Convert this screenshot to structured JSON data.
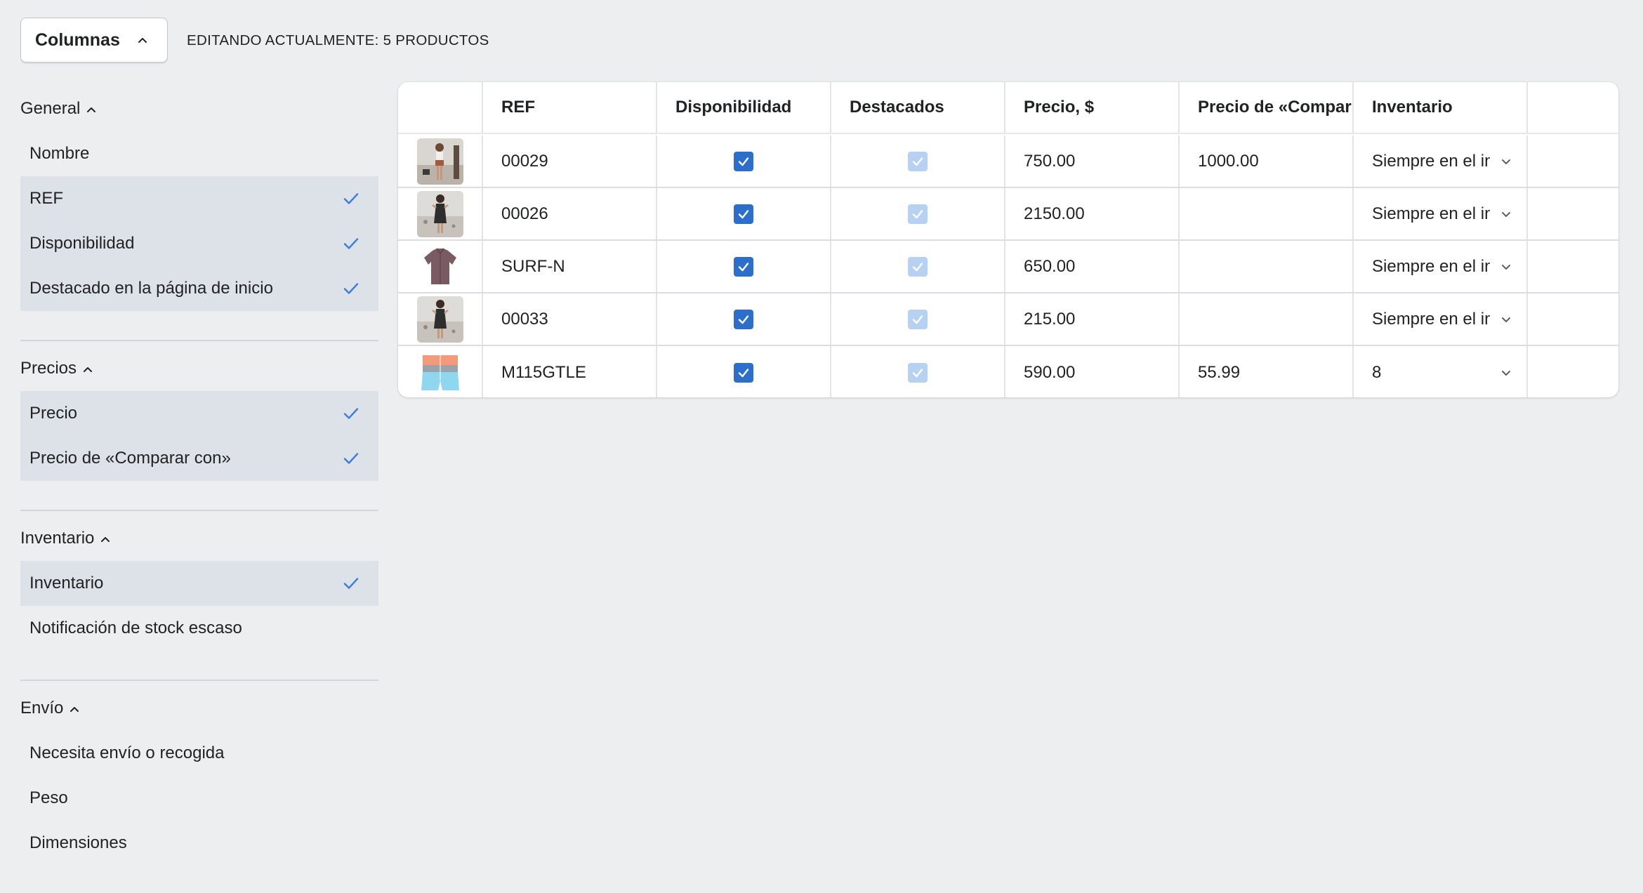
{
  "toolbar": {
    "columns_label": "Columnas",
    "editing_label": "EDITANDO ACTUALMENTE: 5 PRODUCTOS"
  },
  "sidebar": {
    "groups": [
      {
        "title": "General",
        "items": [
          {
            "label": "Nombre",
            "selected": false
          },
          {
            "label": "REF",
            "selected": true
          },
          {
            "label": "Disponibilidad",
            "selected": true
          },
          {
            "label": "Destacado en la página de inicio",
            "selected": true
          }
        ]
      },
      {
        "title": "Precios",
        "items": [
          {
            "label": "Precio",
            "selected": true
          },
          {
            "label": "Precio de «Comparar con»",
            "selected": true
          }
        ]
      },
      {
        "title": "Inventario",
        "items": [
          {
            "label": "Inventario",
            "selected": true
          },
          {
            "label": "Notificación de stock escaso",
            "selected": false
          }
        ]
      },
      {
        "title": "Envío",
        "items": [
          {
            "label": "Necesita envío o recogida",
            "selected": false
          },
          {
            "label": "Peso",
            "selected": false
          },
          {
            "label": "Dimensiones",
            "selected": false
          }
        ]
      }
    ]
  },
  "table": {
    "headers": {
      "ref": "REF",
      "availability": "Disponibilidad",
      "featured": "Destacados",
      "price": "Precio, $",
      "compare": "Precio de «Compar",
      "inventory": "Inventario"
    },
    "rows": [
      {
        "thumb": "woman-beach",
        "ref": "00029",
        "available": true,
        "featured": true,
        "price": "750.00",
        "compare": "1000.00",
        "inventory": "Siempre en el inventario"
      },
      {
        "thumb": "woman-dress",
        "ref": "00026",
        "available": true,
        "featured": true,
        "price": "2150.00",
        "compare": "",
        "inventory": "Siempre en el inventario"
      },
      {
        "thumb": "shirt",
        "ref": "SURF-N",
        "available": true,
        "featured": true,
        "price": "650.00",
        "compare": "",
        "inventory": "Siempre en el inventario"
      },
      {
        "thumb": "woman-dress",
        "ref": "00033",
        "available": true,
        "featured": true,
        "price": "215.00",
        "compare": "",
        "inventory": "Siempre en el inventario"
      },
      {
        "thumb": "shorts",
        "ref": "M115GTLE",
        "available": true,
        "featured": true,
        "price": "590.00",
        "compare": "55.99",
        "inventory": "8"
      }
    ]
  },
  "colors": {
    "accent": "#2c6ecb",
    "accent_disabled": "#b7d1f3",
    "selected_bg": "#dde1e8",
    "check": "#3b7ddd"
  }
}
